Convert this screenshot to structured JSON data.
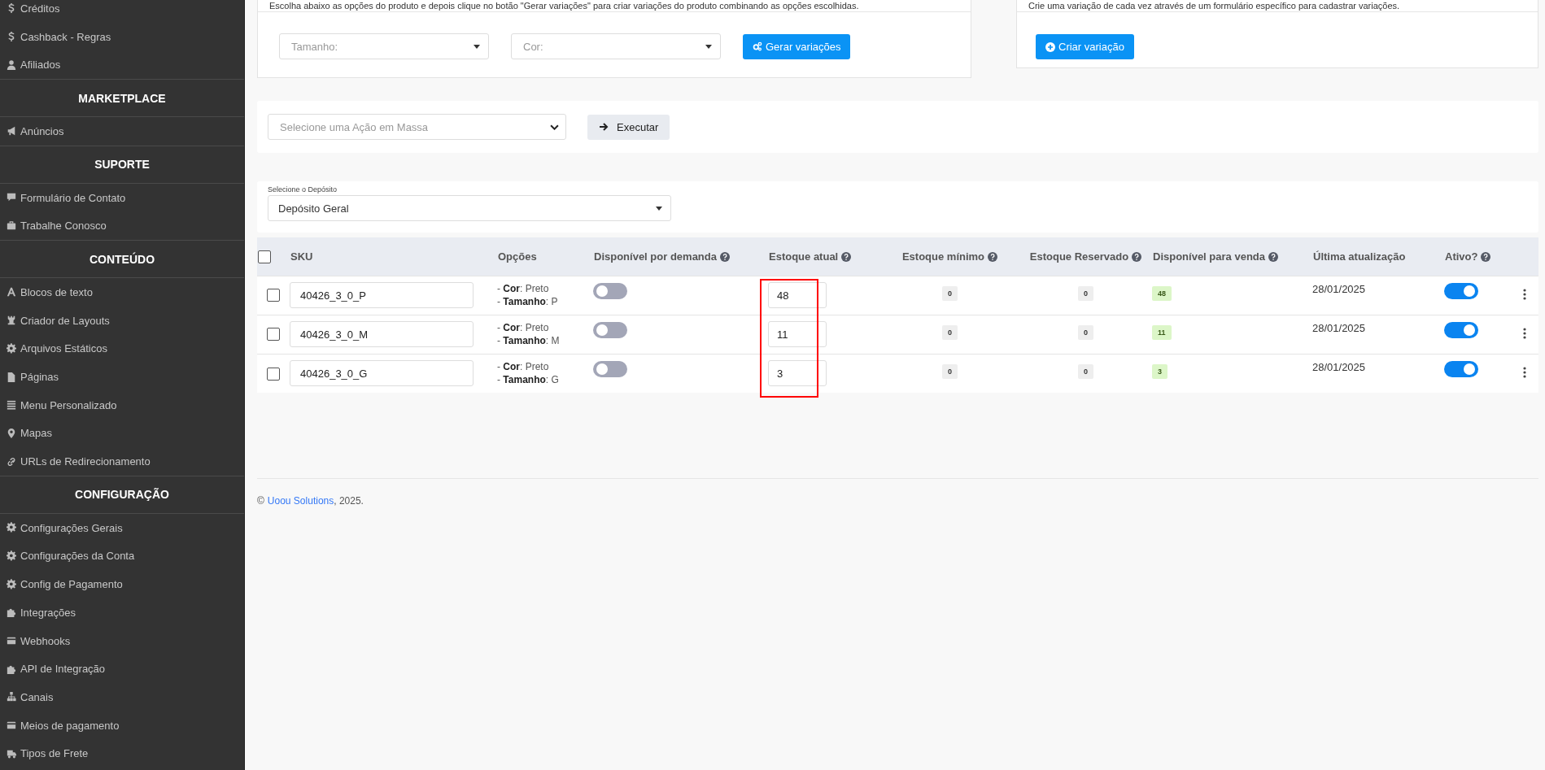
{
  "sidebar": {
    "sections": [
      {
        "items": [
          {
            "label": "Créditos",
            "kind": "dollar"
          },
          {
            "label": "Cashback - Regras",
            "kind": "dollar"
          },
          {
            "label": "Afiliados",
            "kind": "user"
          }
        ]
      },
      {
        "title": "MARKETPLACE",
        "items": [
          {
            "label": "Anúncios",
            "kind": "megaphone"
          }
        ]
      },
      {
        "title": "SUPORTE",
        "items": [
          {
            "label": "Formulário de Contato",
            "kind": "comment"
          },
          {
            "label": "Trabalhe Conosco",
            "kind": "briefcase"
          }
        ]
      },
      {
        "title": "CONTEÚDO",
        "items": [
          {
            "label": "Blocos de texto",
            "kind": "font"
          },
          {
            "label": "Criador de Layouts",
            "kind": "chess"
          },
          {
            "label": "Arquivos Estáticos",
            "kind": "gear"
          },
          {
            "label": "Páginas",
            "kind": "file"
          },
          {
            "label": "Menu Personalizado",
            "kind": "lines"
          },
          {
            "label": "Mapas",
            "kind": "pin"
          },
          {
            "label": "URLs de Redirecionamento",
            "kind": "link"
          }
        ]
      },
      {
        "title": "CONFIGURAÇÃO",
        "items": [
          {
            "label": "Configurações Gerais",
            "kind": "gear"
          },
          {
            "label": "Configurações da Conta",
            "kind": "gear"
          },
          {
            "label": "Config de Pagamento",
            "kind": "gear"
          },
          {
            "label": "Integrações",
            "kind": "puzzle"
          },
          {
            "label": "Webhooks",
            "kind": "card"
          },
          {
            "label": "API de Integração",
            "kind": "puzzle"
          },
          {
            "label": "Canais",
            "kind": "sitemap"
          },
          {
            "label": "Meios de pagamento",
            "kind": "card"
          },
          {
            "label": "Tipos de Frete",
            "kind": "truck"
          }
        ]
      }
    ]
  },
  "generate_card": {
    "description": "Escolha abaixo as opções do produto e depois clique no botão \"Gerar variações\" para criar variações do produto combinando as opções escolhidas.",
    "selects": [
      {
        "placeholder": "Tamanho:"
      },
      {
        "placeholder": "Cor:"
      }
    ],
    "button": "Gerar variações"
  },
  "create_card": {
    "description": "Crie uma variação de cada vez através de um formulário específico para cadastrar variações.",
    "button": "Criar variação"
  },
  "bulk_action": {
    "placeholder": "Selecione uma Ação em Massa",
    "button": "Executar"
  },
  "warehouse": {
    "label": "Selecione o Depósito",
    "value": "Depósito Geral"
  },
  "table": {
    "select_all_checked": false,
    "columns": [
      {
        "label": "SKU",
        "help": false
      },
      {
        "label": "Opções",
        "help": false
      },
      {
        "label": "Disponível por demanda",
        "help": true
      },
      {
        "label": "Estoque atual",
        "help": true
      },
      {
        "label": "Estoque mínimo",
        "help": true
      },
      {
        "label": "Estoque Reservado",
        "help": true
      },
      {
        "label": "Disponível para venda",
        "help": true
      },
      {
        "label": "Última atualização",
        "help": false
      },
      {
        "label": "Ativo?",
        "help": true
      }
    ],
    "rows": [
      {
        "checked": false,
        "sku": "40426_3_0_P",
        "options": [
          "- **Cor**: Preto",
          "- **Tamanho**: P"
        ],
        "on_demand": false,
        "stock": "48",
        "minimum": {
          "value": "0",
          "kind": "neutral"
        },
        "reserved": {
          "value": "0",
          "kind": "neutral"
        },
        "available": {
          "value": "48",
          "kind": "success"
        },
        "updated": "28/01/2025",
        "active": true
      },
      {
        "checked": false,
        "sku": "40426_3_0_M",
        "options": [
          "- **Cor**: Preto",
          "- **Tamanho**: M"
        ],
        "on_demand": false,
        "stock": "11",
        "minimum": {
          "value": "0",
          "kind": "neutral"
        },
        "reserved": {
          "value": "0",
          "kind": "neutral"
        },
        "available": {
          "value": "11",
          "kind": "success"
        },
        "updated": "28/01/2025",
        "active": true
      },
      {
        "checked": false,
        "sku": "40426_3_0_G",
        "options": [
          "- **Cor**: Preto",
          "- **Tamanho**: G"
        ],
        "on_demand": false,
        "stock": "3",
        "minimum": {
          "value": "0",
          "kind": "neutral"
        },
        "reserved": {
          "value": "0",
          "kind": "neutral"
        },
        "available": {
          "value": "3",
          "kind": "success"
        },
        "updated": "28/01/2025",
        "active": true
      }
    ],
    "stock_outline": {
      "color": "#ff0000"
    }
  },
  "footer": {
    "symbol": "©",
    "link": "Uoou Solutions",
    "text": ", 2025."
  }
}
